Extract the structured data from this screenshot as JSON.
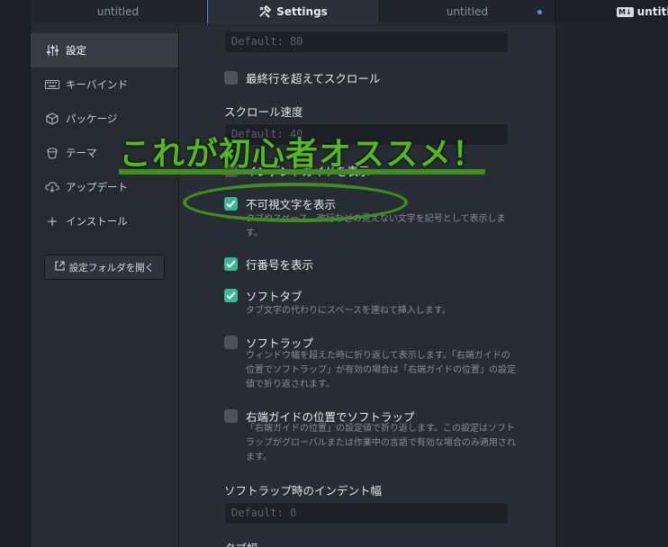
{
  "tabs": [
    {
      "label": "untitled",
      "active": false
    },
    {
      "label": "Settings",
      "active": true,
      "icon": "tools-icon"
    },
    {
      "label": "untitled",
      "active": false,
      "modified": true
    },
    {
      "label": "untitled",
      "badge": "M↓",
      "active": false
    }
  ],
  "sidebar": {
    "items": [
      {
        "label": "設定",
        "icon": "sliders-icon",
        "selected": true
      },
      {
        "label": "キーバインド",
        "icon": "keyboard-icon"
      },
      {
        "label": "パッケージ",
        "icon": "package-icon"
      },
      {
        "label": "テーマ",
        "icon": "paintbucket-icon"
      },
      {
        "label": "アップデート",
        "icon": "cloud-download-icon"
      },
      {
        "label": "インストール",
        "icon": "plus-icon"
      }
    ],
    "open_folder_button": "設定フォルダを開く"
  },
  "settings": {
    "top_input_value": "Default: 80",
    "scroll_past_end": {
      "label": "最終行を超えてスクロール",
      "checked": false
    },
    "scroll_speed": {
      "label": "スクロール速度",
      "value": "Default: 40"
    },
    "indent_guide": {
      "label": "インデントガイドを表示",
      "checked": false
    },
    "show_invisibles": {
      "label": "不可視文字を表示",
      "checked": true,
      "description": "タブやスペース、改行などの見えない文字を記号として表示します。"
    },
    "show_line_numbers": {
      "label": "行番号を表示",
      "checked": true
    },
    "soft_tabs": {
      "label": "ソフトタブ",
      "checked": true,
      "description": "タブ文字の代わりにスペースを連ねて挿入します。"
    },
    "soft_wrap": {
      "label": "ソフトラップ",
      "checked": false,
      "description": "ウィンドウ幅を超えた時に折り返して表示します。「右端ガイドの位置でソフトラップ」が有効の場合は「右端ガイドの位置」の設定値で折り返されます。"
    },
    "soft_wrap_guide": {
      "label": "右端ガイドの位置でソフトラップ",
      "checked": false,
      "description": "「右端ガイドの位置」の設定値で折り返します。この設定はソフトラップがグローバルまたは作業中の言語で有効な場合のみ適用されます。"
    },
    "soft_wrap_indent": {
      "label": "ソフトラップ時のインデント幅",
      "value": "Default: 0"
    },
    "tab_length": {
      "label": "タブ幅"
    }
  },
  "annotation": {
    "callout_text": "これが初心者オススメ！",
    "color": "#52b81e"
  }
}
